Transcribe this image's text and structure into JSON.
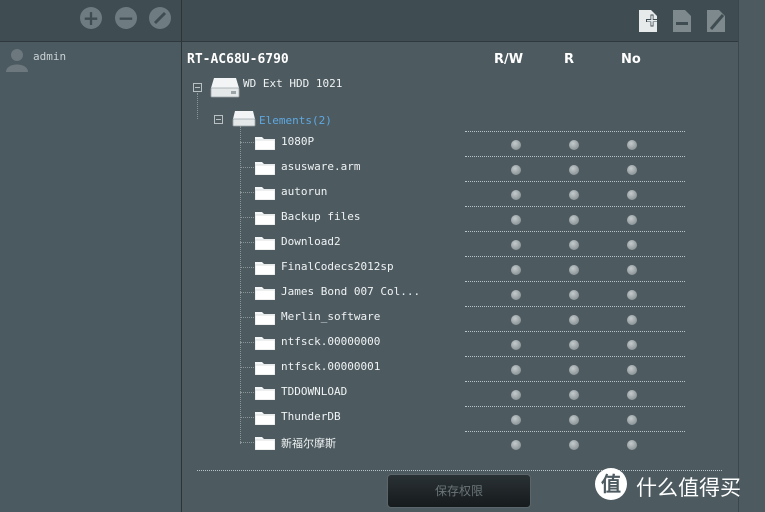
{
  "left_toolbar": {
    "add_icon": "plus-circle-icon",
    "remove_icon": "minus-circle-icon",
    "edit_icon": "pencil-circle-icon"
  },
  "users": [
    {
      "name": "admin",
      "icon": "user-avatar-icon"
    }
  ],
  "right_toolbar": {
    "icons": [
      "file-add-icon",
      "file-remove-icon",
      "file-edit-icon"
    ]
  },
  "router_name": "RT-AC68U-6790",
  "columns": [
    "R/W",
    "R",
    "No"
  ],
  "drive": {
    "label": "WD Ext HDD 1021",
    "partition_label": "Elements(2)"
  },
  "folders": [
    "1080P",
    "asusware.arm",
    "autorun",
    "Backup files",
    "Download2",
    "FinalCodecs2012sp",
    "James Bond 007 Col...",
    "Merlin_software",
    "ntfsck.00000000",
    "ntfsck.00000001",
    "TDDOWNLOAD",
    "ThunderDB",
    "新福尔摩斯"
  ],
  "save_button": "保存权限",
  "watermark": {
    "badge": "值",
    "text": "什么值得买"
  },
  "colors": {
    "background": "#4d5b61",
    "toolbar": "#3f4c51",
    "link_blue": "#5fa8e0"
  }
}
